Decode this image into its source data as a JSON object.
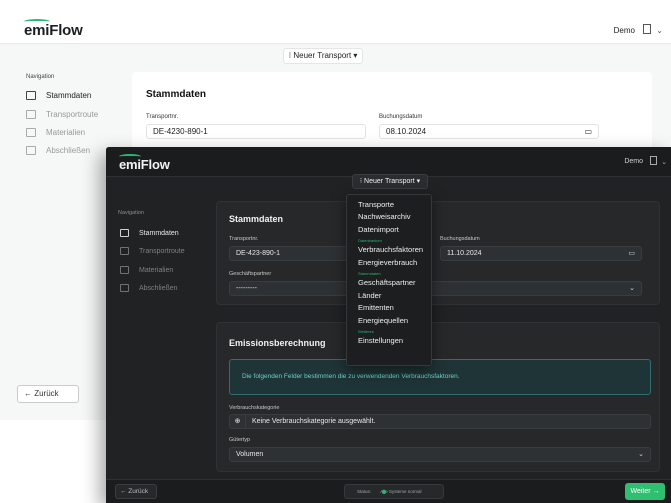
{
  "light": {
    "logo": "emiFlow",
    "user": "Demo",
    "new_transport": "⁝ Neuer Transport ▾",
    "nav_title": "Navigation",
    "nav": [
      {
        "label": "Stammdaten"
      },
      {
        "label": "Transportroute"
      },
      {
        "label": "Materialien"
      },
      {
        "label": "Abschließen"
      }
    ],
    "card_title": "Stammdaten",
    "transport_label": "Transportnr.",
    "transport_value": "DE-4230-890-1",
    "booking_label": "Buchungsdatum",
    "booking_value": "08.10.2024",
    "back_button": "← Zurück"
  },
  "dark": {
    "logo": "emiFlow",
    "user": "Demo",
    "new_transport": "⁝ Neuer Transport ▾",
    "nav_title": "Navigation",
    "nav": [
      {
        "label": "Stammdaten"
      },
      {
        "label": "Transportroute"
      },
      {
        "label": "Materialien"
      },
      {
        "label": "Abschließen"
      }
    ],
    "card_title": "Stammdaten",
    "transport_label": "Transportnr.",
    "transport_value": "DE-423-890-1",
    "booking_label": "Buchungsdatum",
    "booking_value": "11.10.2024",
    "partner_label": "Geschäftspartner",
    "partner_value": "---------",
    "emission_title": "Emissionsberechnung",
    "info_text": "Die folgenden Felder bestimmen die zu verwendenden Verbrauchsfaktoren.",
    "category_label": "Verbrauchskategorie",
    "category_value": "Keine Verbrauchskategorie ausgewählt.",
    "goods_label": "Gütertyp",
    "goods_value": "Volumen",
    "back_button": "← Zurück",
    "status_text": "Status:",
    "status_value": "Alle Systeme normal",
    "next_button": "Weiter →"
  },
  "menu": {
    "items": [
      "Transporte",
      "Nachweisarchiv",
      "Datenimport",
      "Datenbanken",
      "Verbrauchsfaktoren",
      "Energieverbrauch",
      "Stammdaten",
      "Geschäftspartner",
      "Länder",
      "Emittenten",
      "Energiequellen",
      "Weiteres",
      "Einstellungen"
    ]
  },
  "colors": {
    "accent": "#2bb673",
    "dark_bg": "#202223",
    "info_text": "#6ad0c9"
  }
}
